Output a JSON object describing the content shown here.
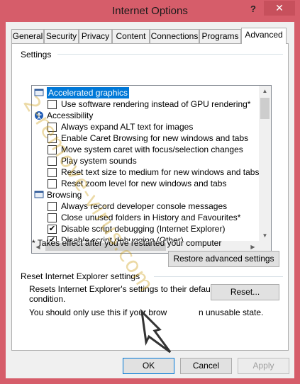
{
  "window": {
    "title": "Internet Options",
    "help_glyph": "?",
    "close_glyph": "✕"
  },
  "tabs": [
    {
      "label": "General"
    },
    {
      "label": "Security"
    },
    {
      "label": "Privacy"
    },
    {
      "label": "Content"
    },
    {
      "label": "Connections"
    },
    {
      "label": "Programs"
    },
    {
      "label": "Advanced",
      "active": true
    }
  ],
  "settings": {
    "group_label": "Settings",
    "rows": [
      {
        "kind": "category",
        "icon": "monitor-icon",
        "label": "Accelerated graphics",
        "selected": true
      },
      {
        "kind": "option",
        "label": "Use software rendering instead of GPU rendering*",
        "checked": false
      },
      {
        "kind": "category",
        "icon": "accessibility-icon",
        "label": "Accessibility"
      },
      {
        "kind": "option",
        "label": "Always expand ALT text for images",
        "checked": false
      },
      {
        "kind": "option",
        "label": "Enable Caret Browsing for new windows and tabs",
        "checked": false
      },
      {
        "kind": "option",
        "label": "Move system caret with focus/selection changes",
        "checked": false
      },
      {
        "kind": "option",
        "label": "Play system sounds",
        "checked": false
      },
      {
        "kind": "option",
        "label": "Reset text size to medium for new windows and tabs",
        "checked": false
      },
      {
        "kind": "option",
        "label": "Reset zoom level for new windows and tabs",
        "checked": false
      },
      {
        "kind": "category",
        "icon": "browsing-icon",
        "label": "Browsing"
      },
      {
        "kind": "option",
        "label": "Always record developer console messages",
        "checked": false
      },
      {
        "kind": "option",
        "label": "Close unused folders in History and Favourites*",
        "checked": false
      },
      {
        "kind": "option",
        "label": "Disable script debugging (Internet Explorer)",
        "checked": true
      },
      {
        "kind": "option",
        "label": "Disable script debugging (Other)",
        "checked": true
      }
    ],
    "note": "* Takes effect after you've restarted your computer",
    "restore_button": "Restore advanced settings"
  },
  "reset": {
    "group_label": "Reset Internet Explorer settings",
    "description_line1": "Resets Internet Explorer's settings to their default",
    "description_line2": "condition.",
    "reset_button": "Reset...",
    "warning": "You should only use this if your brow",
    "warning_tail": "n unusable state."
  },
  "footer": {
    "ok": "OK",
    "cancel": "Cancel",
    "apply": "Apply"
  },
  "watermark": {
    "text": "2-remove-virus.com"
  },
  "colors": {
    "titlebar": "#d65d6a",
    "close": "#c7505c",
    "selection": "#0078d7",
    "watermark": "#c89600"
  }
}
